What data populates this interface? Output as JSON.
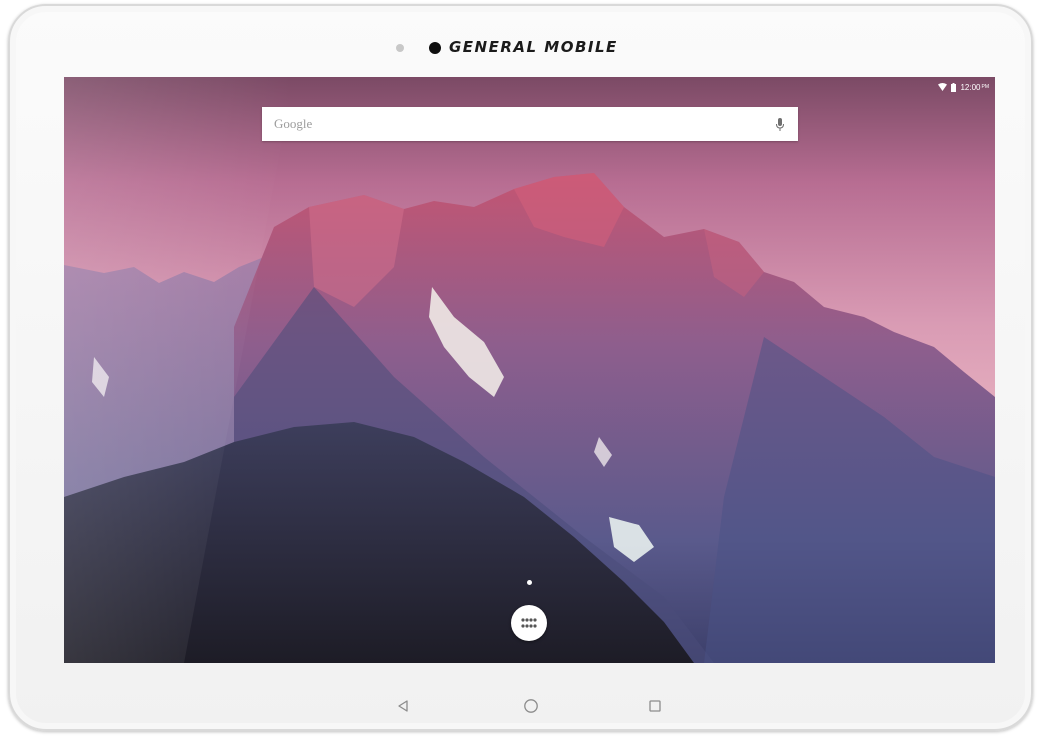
{
  "device": {
    "brand": "GENERAL MOBILE"
  },
  "status_bar": {
    "time": "12:00",
    "ampm": "PM",
    "icons": [
      "wifi-icon",
      "battery-icon"
    ]
  },
  "search": {
    "label": "Google",
    "icon": "mic-icon"
  },
  "home": {
    "page_indicator_count": 1,
    "app_drawer_icon": "apps-grid-icon"
  },
  "nav_bar": {
    "icons": [
      "back-icon",
      "home-icon",
      "recents-icon"
    ]
  },
  "colors": {
    "sky_top": "#7a4a66",
    "sky_mid": "#c77b9b",
    "mountain_shadow": "#3f3c63",
    "bezel": "#f4f4f4"
  }
}
